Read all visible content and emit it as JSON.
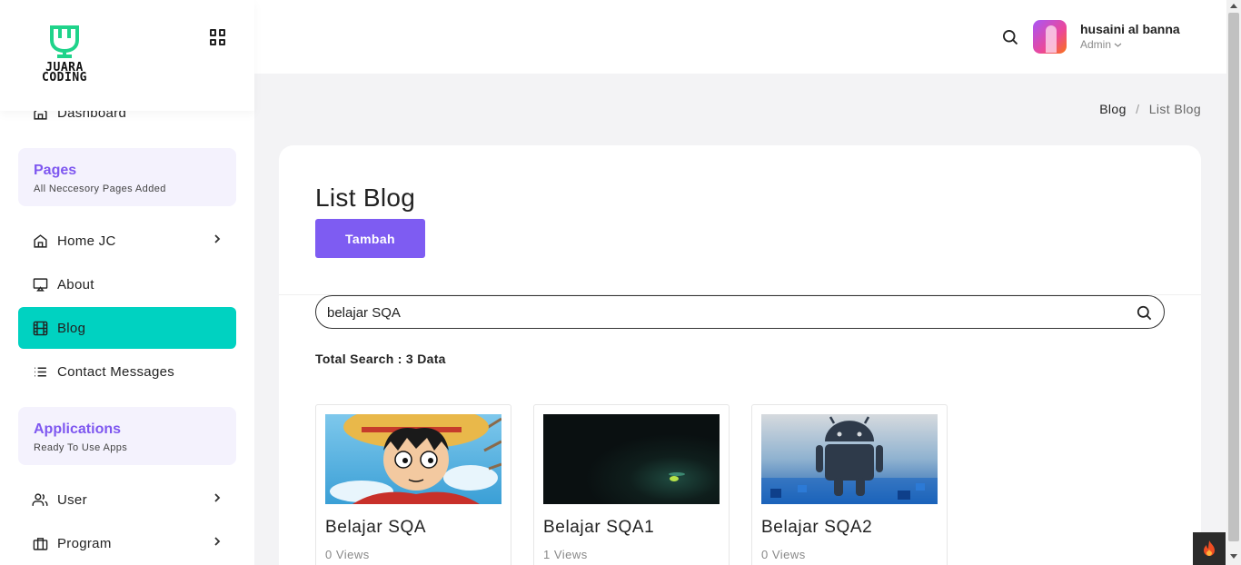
{
  "brand": {
    "logo_text_1": "JUARA",
    "logo_text_2": "CODING",
    "accent": "#00d2c1",
    "primary": "#7e5cf2",
    "logo_color": "#1fd38a"
  },
  "sidebar": {
    "items": [
      {
        "label": "Dashboard",
        "icon": "home-icon"
      },
      {
        "label": "Home JC",
        "icon": "home-icon"
      },
      {
        "label": "About",
        "icon": "monitor-icon"
      },
      {
        "label": "Blog",
        "icon": "film-icon",
        "active": true
      },
      {
        "label": "Contact Messages",
        "icon": "list-icon"
      },
      {
        "label": "User",
        "icon": "users-icon"
      },
      {
        "label": "Program",
        "icon": "briefcase-icon"
      }
    ],
    "sections": [
      {
        "title": "Pages",
        "subtitle": "All Neccesory Pages Added"
      },
      {
        "title": "Applications",
        "subtitle": "Ready To Use Apps"
      }
    ]
  },
  "header": {
    "user_name": "husaini al banna",
    "user_role": "Admin"
  },
  "breadcrumb": {
    "items": [
      "Blog",
      "List Blog"
    ]
  },
  "main": {
    "title": "List Blog",
    "add_button": "Tambah",
    "search_value": "belajar SQA",
    "total_search": "Total Search : 3 Data",
    "posts": [
      {
        "title": "Belajar SQA",
        "views": "0 Views",
        "thumbnail": "anime-character-image"
      },
      {
        "title": "Belajar SQA1",
        "views": "1 Views",
        "thumbnail": "dark-scene-image"
      },
      {
        "title": "Belajar SQA2",
        "views": "0 Views",
        "thumbnail": "android-robot-image"
      }
    ]
  }
}
